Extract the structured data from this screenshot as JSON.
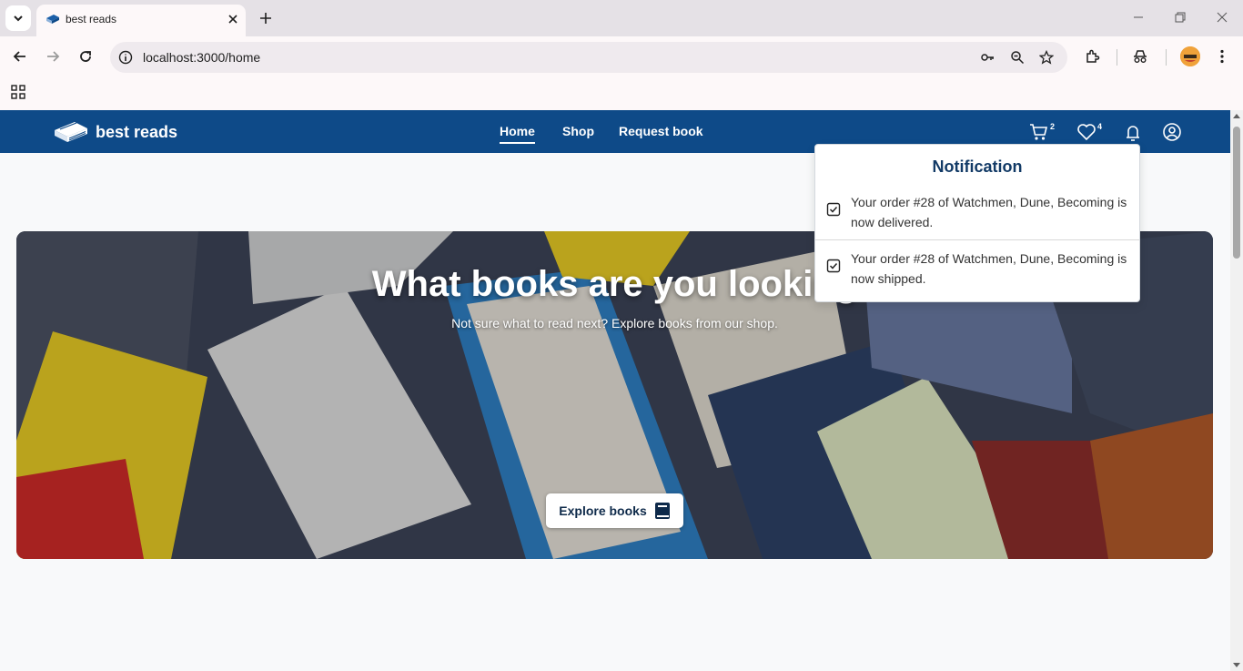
{
  "browser": {
    "tab_title": "best reads",
    "url": "localhost:3000/home"
  },
  "navbar": {
    "brand": "best reads",
    "links": [
      "Home",
      "Shop",
      "Request book"
    ],
    "cart_count": "2",
    "wishlist_count": "4"
  },
  "hero": {
    "title": "What books are you looking",
    "subtitle": "Not sure what to read next? Explore books from our shop.",
    "cta": "Explore books"
  },
  "notifications": {
    "title": "Notification",
    "items": [
      "Your order #28 of Watchmen, Dune, Becoming is now delivered.",
      "Your order #28 of Watchmen, Dune, Becoming is now shipped."
    ]
  },
  "colors": {
    "navbar": "#0e4a88",
    "notification_title": "#123a66"
  }
}
